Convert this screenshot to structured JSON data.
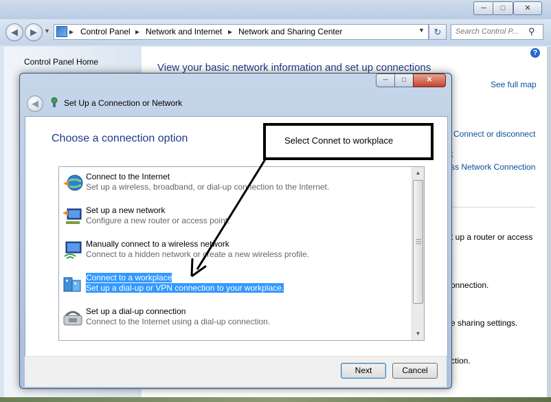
{
  "window": {
    "caption_buttons": [
      "─",
      "□",
      "✕"
    ]
  },
  "address_bar": {
    "breadcrumbs": [
      "Control Panel",
      "Network and Internet",
      "Network and Sharing Center"
    ],
    "search_placeholder": "Search Control P..."
  },
  "left_pane": {
    "home_link": "Control Panel Home"
  },
  "main_pane": {
    "heading": "View your basic network information and set up connections",
    "see_full_map": "See full map",
    "partial": {
      "connect_disconnect": "Connect or disconnect",
      "t_fragment": "t",
      "network_connection": "ss Network Connection",
      "router_text": "t up a router or access",
      "connection1": "onnection.",
      "sharing": "e sharing settings.",
      "connection2": "ction."
    }
  },
  "dialog": {
    "title": "Set Up a Connection or Network",
    "heading": "Choose a connection option",
    "options": [
      {
        "title": "Connect to the Internet",
        "desc": "Set up a wireless, broadband, or dial-up connection to the Internet.",
        "icon": "globe-icon"
      },
      {
        "title": "Set up a new network",
        "desc": "Configure a new router or access point.",
        "icon": "network-setup-icon"
      },
      {
        "title": "Manually connect to a wireless network",
        "desc": "Connect to a hidden network or create a new wireless profile.",
        "icon": "wireless-monitor-icon"
      },
      {
        "title": "Connect to a workplace",
        "desc": "Set up a dial-up or VPN connection to your workplace.",
        "icon": "workplace-icon",
        "selected": true
      },
      {
        "title": "Set up a dial-up connection",
        "desc": "Connect to the Internet using a dial-up connection.",
        "icon": "phone-modem-icon"
      }
    ],
    "buttons": {
      "next": "Next",
      "cancel": "Cancel"
    }
  },
  "annotation": {
    "callout_text": "Select Connet to workplace"
  },
  "colors": {
    "selection": "#3399ff",
    "heading_blue": "#1e3a8a",
    "link_blue": "#0a4d9c"
  }
}
